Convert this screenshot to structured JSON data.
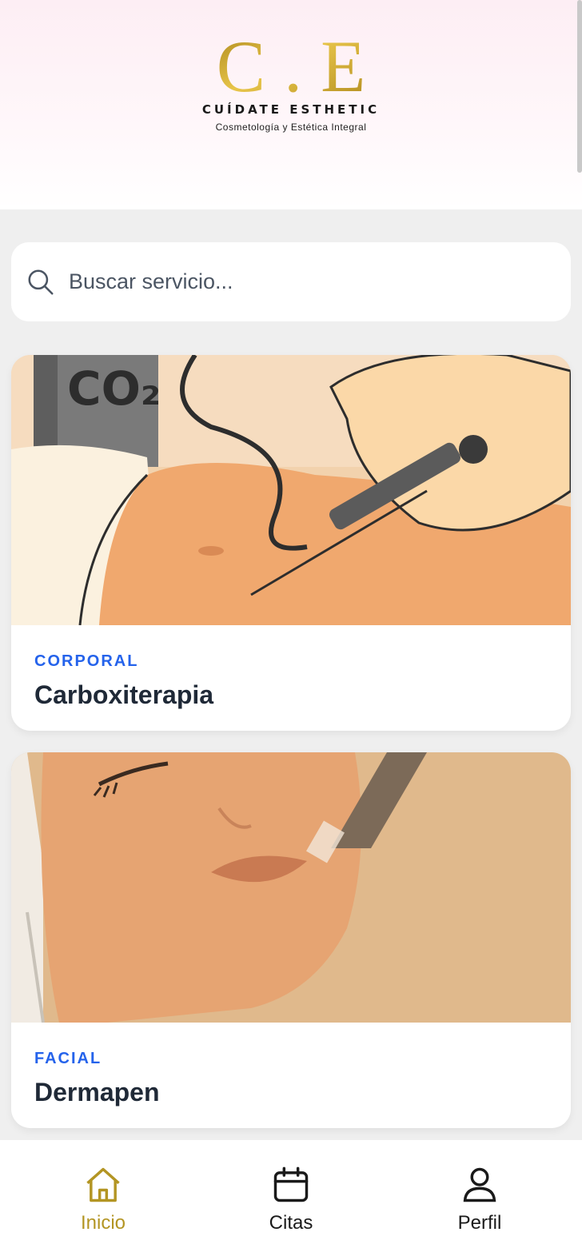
{
  "header": {
    "logo_letters": "C . E",
    "brand": "CUÍDATE ESTHETIC",
    "tagline": "Cosmetología y Estética Integral",
    "logo_color": "#c9a227"
  },
  "search": {
    "placeholder": "Buscar servicio...",
    "value": "",
    "icon": "search-icon"
  },
  "services": [
    {
      "category": "CORPORAL",
      "title": "Carboxiterapia",
      "image_label": "CO₂"
    },
    {
      "category": "FACIAL",
      "title": "Dermapen"
    }
  ],
  "nav": {
    "items": [
      {
        "label": "Inicio",
        "icon": "home-icon",
        "active": true
      },
      {
        "label": "Citas",
        "icon": "calendar-icon",
        "active": false
      },
      {
        "label": "Perfil",
        "icon": "user-icon",
        "active": false
      }
    ],
    "active_color": "#b39523"
  },
  "colors": {
    "accent_blue": "#2563eb",
    "gold": "#b39523"
  }
}
